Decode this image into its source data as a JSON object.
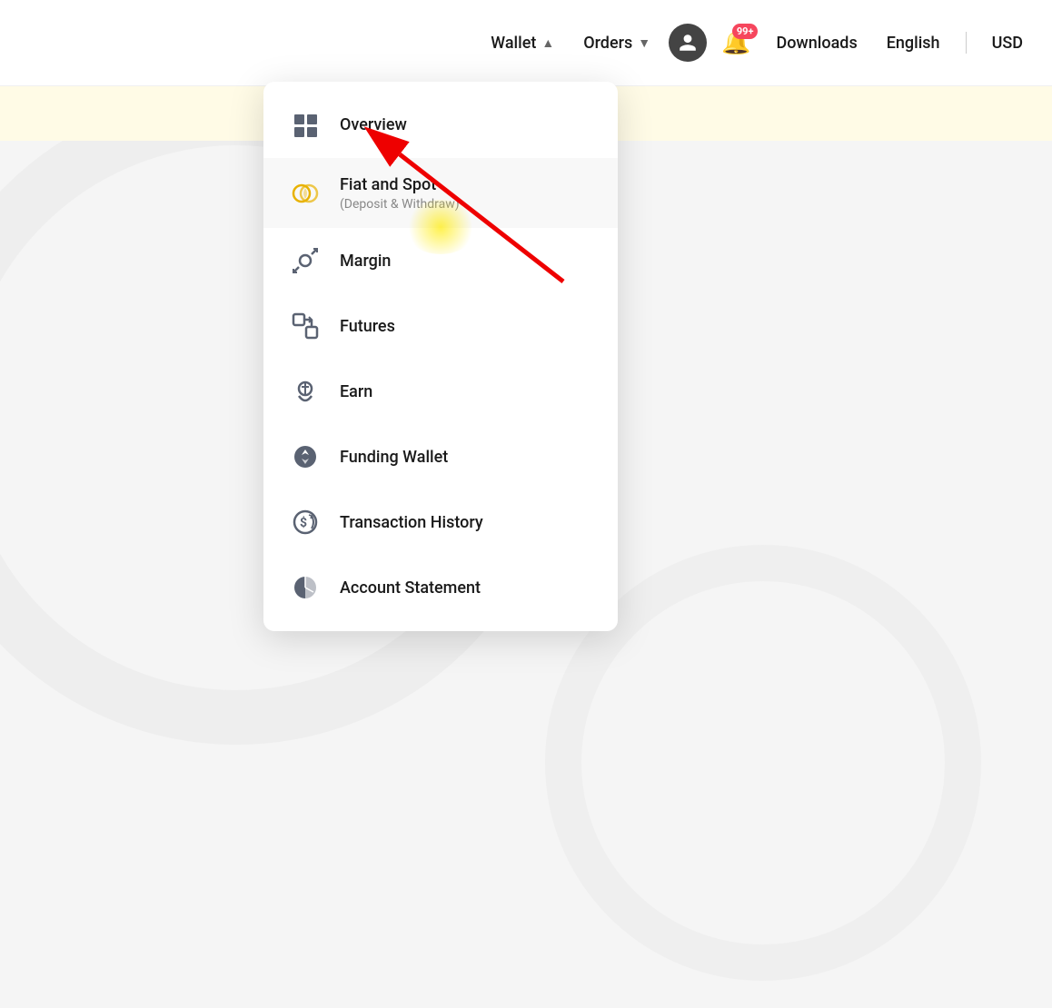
{
  "navbar": {
    "wallet_label": "Wallet",
    "orders_label": "Orders",
    "downloads_label": "Downloads",
    "english_label": "English",
    "currency_label": "USD",
    "notification_badge": "99+"
  },
  "dropdown": {
    "items": [
      {
        "id": "overview",
        "label": "Overview",
        "sublabel": "",
        "icon_type": "grid"
      },
      {
        "id": "fiat-spot",
        "label": "Fiat and Spot",
        "sublabel": "(Deposit & Withdraw)",
        "icon_type": "fiat"
      },
      {
        "id": "margin",
        "label": "Margin",
        "sublabel": "",
        "icon_type": "margin"
      },
      {
        "id": "futures",
        "label": "Futures",
        "sublabel": "",
        "icon_type": "futures"
      },
      {
        "id": "earn",
        "label": "Earn",
        "sublabel": "",
        "icon_type": "earn"
      },
      {
        "id": "funding",
        "label": "Funding Wallet",
        "sublabel": "",
        "icon_type": "funding"
      },
      {
        "id": "history",
        "label": "Transaction History",
        "sublabel": "",
        "icon_type": "history"
      },
      {
        "id": "statement",
        "label": "Account Statement",
        "sublabel": "",
        "icon_type": "statement"
      }
    ]
  }
}
